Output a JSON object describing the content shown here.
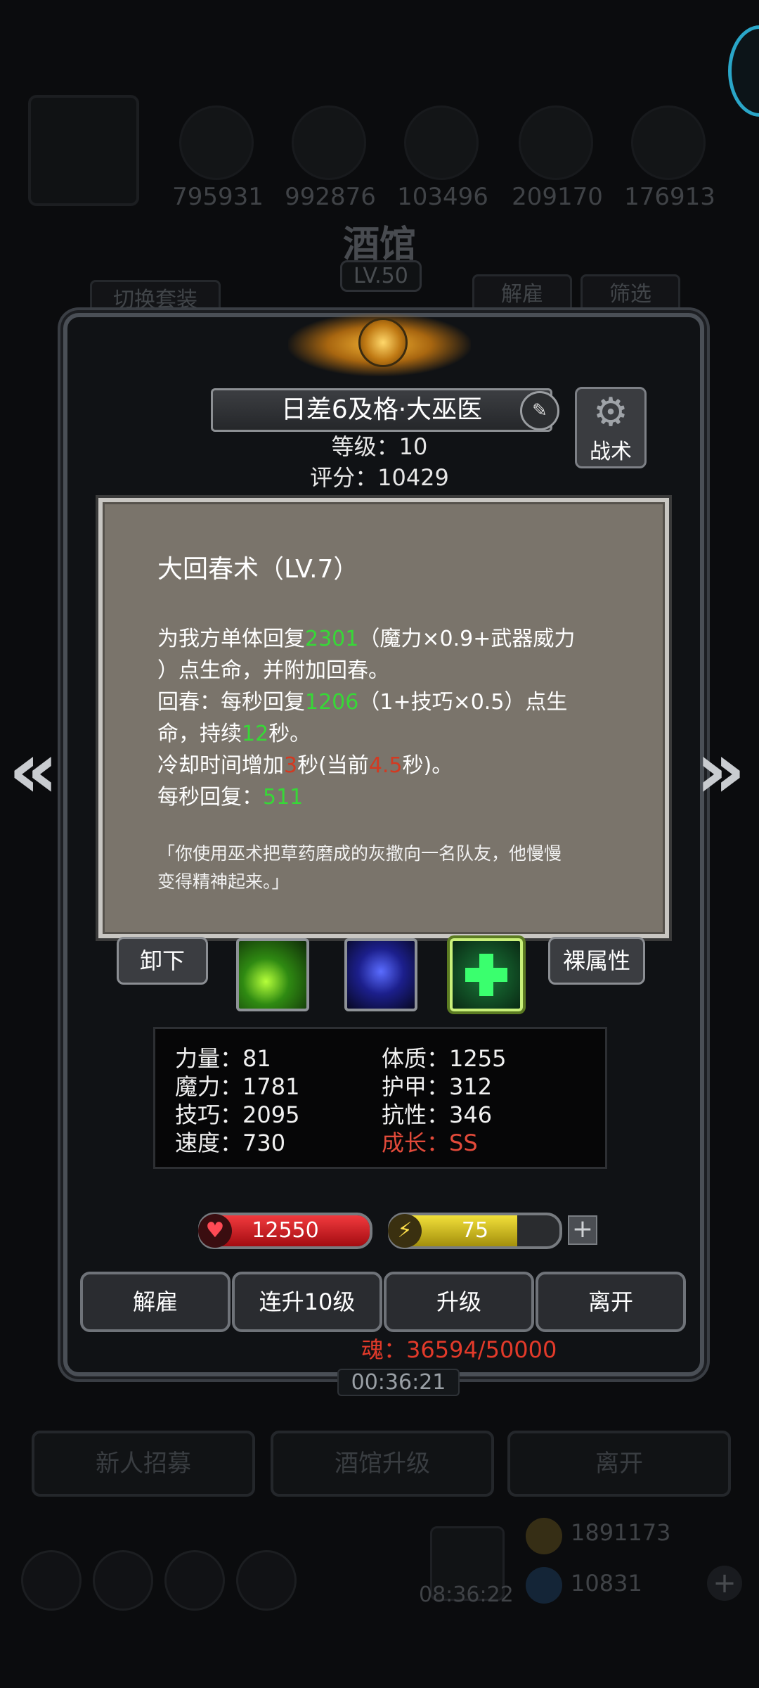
{
  "background": {
    "resources": [
      "795931",
      "992876",
      "103496",
      "209170",
      "176913"
    ],
    "screen_title": "酒馆",
    "tavern_level": "LV.50",
    "switch_outfit": "切换套装",
    "dismiss": "解雇",
    "filter": "筛选",
    "buttons": [
      "新人招募",
      "酒馆升级",
      "离开"
    ],
    "gold": "1891173",
    "gems": "10831",
    "clock": "08:36:22"
  },
  "hero": {
    "name": "日差6及格·大巫医",
    "level": "等级：10",
    "score": "评分：10429",
    "tactics": "战术"
  },
  "tooltip": {
    "title": "大回春术（LV.7）",
    "l1a": "为我方单体回复",
    "l1n": "2301",
    "l1b": "（魔力×0.9+武器威力",
    "l2": "）点生命，并附加回春。",
    "l3a": "回春：每秒回复",
    "l3n": "1206",
    "l3b": "（1+技巧×0.5）点生",
    "l4a": "命，持续",
    "l4n": "12",
    "l4b": "秒。",
    "l5a": "冷却时间增加",
    "l5n": "3",
    "l5b": "秒(当前",
    "l5n2": "4.5",
    "l5c": "秒)。",
    "l6a": "每秒回复：",
    "l6n": "511",
    "quote1": "「你使用巫术把草药磨成的灰撒向一名队友，他慢慢",
    "quote2": "变得精神起来。」"
  },
  "skills": {
    "unequip": "卸下",
    "base_attr": "裸属性"
  },
  "attributes": {
    "strength": "力量：81",
    "magic": "魔力：1781",
    "skill": "技巧：2095",
    "speed": "速度：730",
    "constitution": "体质：1255",
    "armor": "护甲：312",
    "resistance": "抗性：346",
    "growth": "成长：SS"
  },
  "bars": {
    "hp": "12550",
    "hp_fill": 1.0,
    "energy": "75",
    "energy_fill": 0.75
  },
  "actions": {
    "dismiss": "解雇",
    "level10": "连升10级",
    "upgrade": "升级",
    "leave": "离开"
  },
  "soul": "魂：36594/50000",
  "timer": "00:36:21",
  "colors": {
    "highlight_green": "#37d837",
    "highlight_red": "#d23a22",
    "growth_red": "#e24a3a",
    "hp_red": "#c8141a",
    "energy_yellow": "#d9c21c"
  }
}
